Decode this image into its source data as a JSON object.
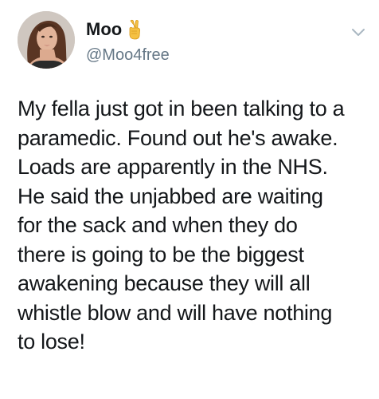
{
  "user": {
    "display_name": "Moo",
    "emoji": "victory-hand",
    "handle": "@Moo4free"
  },
  "menu": {
    "icon": "chevron-down-icon"
  },
  "tweet": {
    "lines": [
      "My fella just got in been talking to a",
      "paramedic. Found out he's awake.",
      "Loads are apparently in the NHS.",
      "He said the unjabbed are waiting",
      "for the sack and when they do",
      "there is going to be the biggest",
      "awakening because they will all",
      "whistle blow and will have nothing",
      "to lose!"
    ]
  },
  "colors": {
    "text": "#14171a",
    "secondary_text": "#657786",
    "chevron": "#aab8c2"
  }
}
